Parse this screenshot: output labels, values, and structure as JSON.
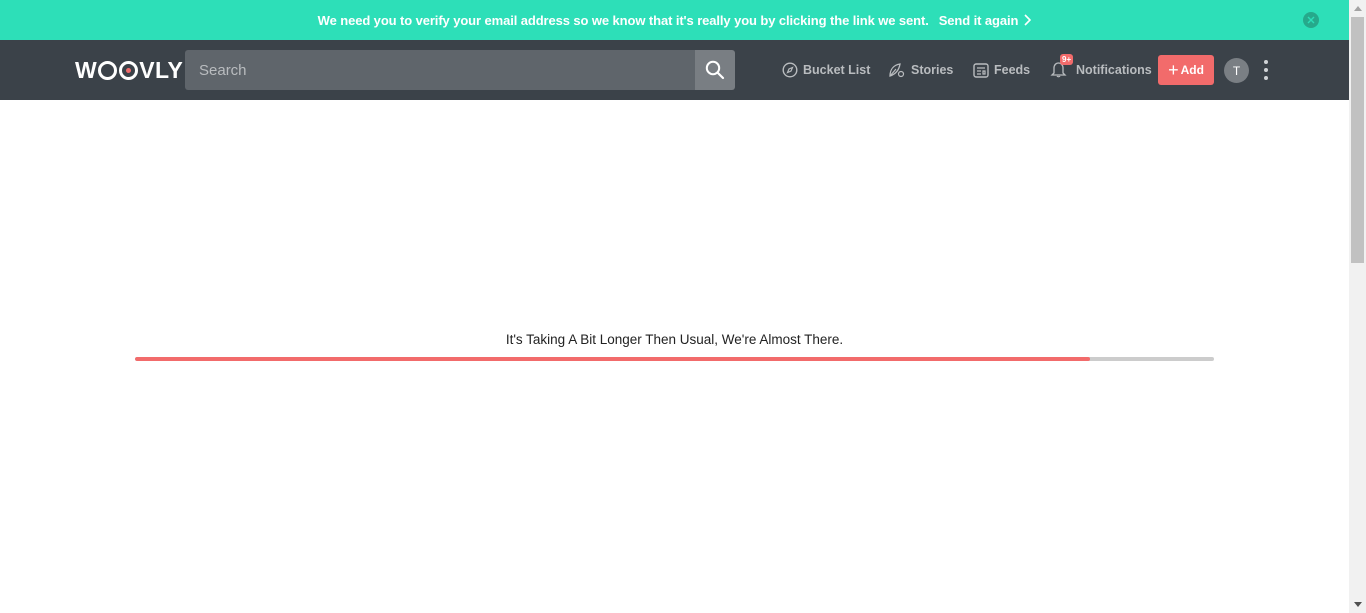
{
  "banner": {
    "message": "We need you to verify your email address so we know that it's really you by clicking the link we sent.",
    "resend_label": "Send it again",
    "background": "#2ddfb8"
  },
  "navbar": {
    "logo": "WOOVLY",
    "search": {
      "placeholder": "Search",
      "value": ""
    },
    "items": [
      {
        "label": "Bucket List",
        "icon": "compass-icon"
      },
      {
        "label": "Stories",
        "icon": "leaf-icon"
      },
      {
        "label": "Feeds",
        "icon": "newspaper-icon"
      },
      {
        "label": "Notifications",
        "icon": "bell-icon",
        "badge": "9+"
      }
    ],
    "add_label": "Add",
    "avatar_initial": "T",
    "background": "#3b4249",
    "accent": "#f26b6b"
  },
  "main": {
    "loading_text": "It's Taking A Bit Longer Then Usual, We're Almost There.",
    "progress": 0.885
  }
}
